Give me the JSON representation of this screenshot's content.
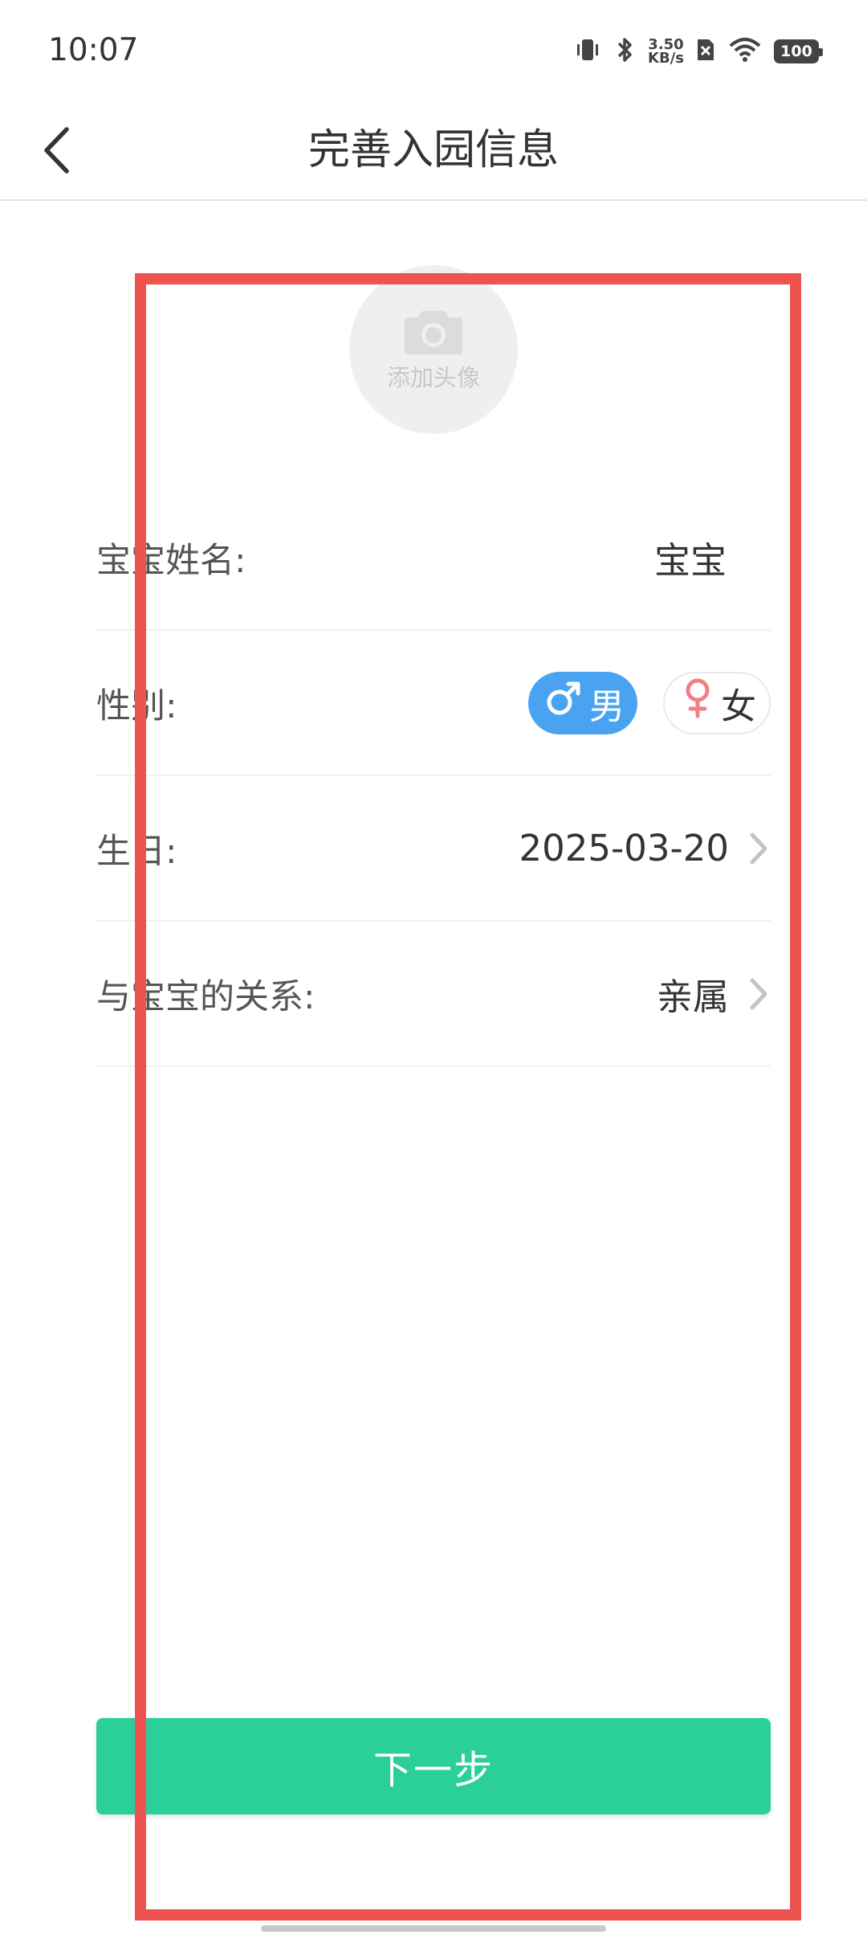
{
  "status_bar": {
    "time": "10:07",
    "net_speed_value": "3.50",
    "net_speed_unit": "KB/s",
    "battery": "100"
  },
  "nav": {
    "title": "完善入园信息"
  },
  "avatar": {
    "label": "添加头像"
  },
  "form": {
    "name": {
      "label": "宝宝姓名:",
      "value": "宝宝"
    },
    "gender": {
      "label": "性别:",
      "options": [
        {
          "symbol": "♂",
          "text": "男",
          "selected": true
        },
        {
          "symbol": "♀",
          "text": "女",
          "selected": false
        }
      ]
    },
    "birthday": {
      "label": "生日:",
      "value": "2025-03-20"
    },
    "relation": {
      "label": "与宝宝的关系:",
      "value": "亲属"
    }
  },
  "next_button": {
    "label": "下一步"
  },
  "colors": {
    "accent_green": "#2bcf9a",
    "male_blue": "#4aa3f0",
    "female_pink": "#f07f86",
    "highlight_red": "#ef5350"
  }
}
